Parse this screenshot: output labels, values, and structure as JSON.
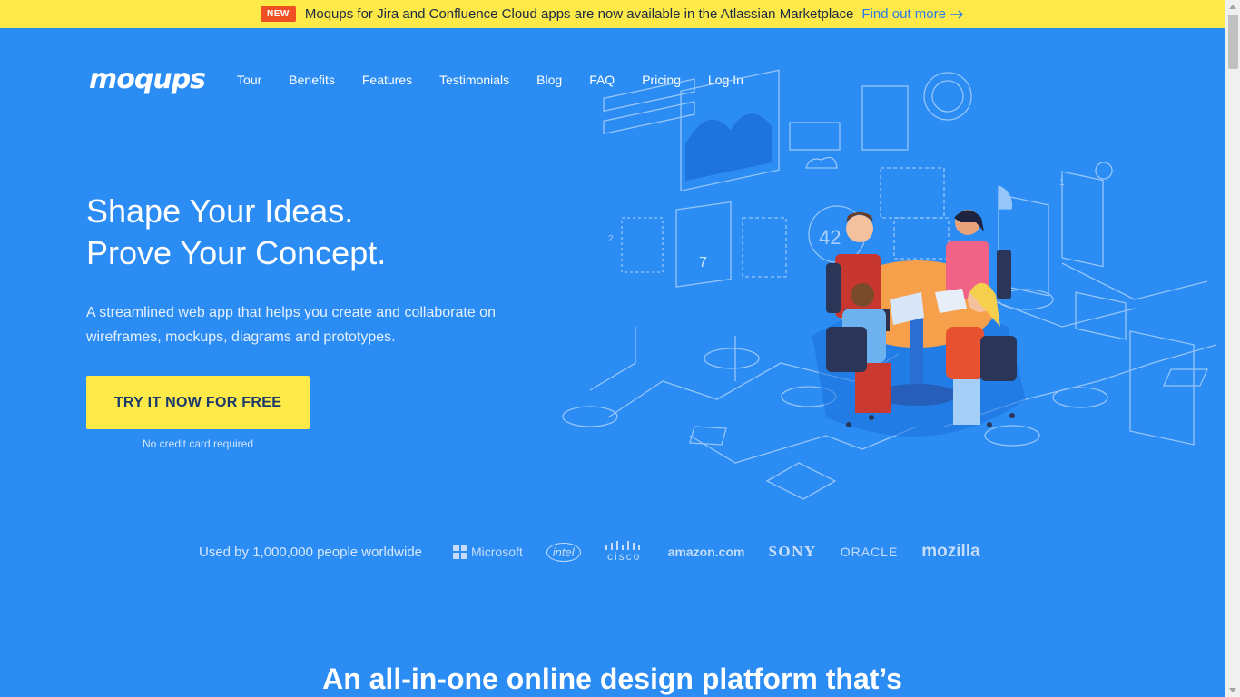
{
  "announcement": {
    "badge": "NEW",
    "text": "Moqups for Jira and Confluence Cloud apps are now available in the Atlassian Marketplace",
    "link": "Find out more"
  },
  "brand": {
    "logo": "moqups"
  },
  "nav": {
    "items": [
      "Tour",
      "Benefits",
      "Features",
      "Testimonials",
      "Blog",
      "FAQ",
      "Pricing",
      "Log In"
    ]
  },
  "hero": {
    "title_line1": "Shape Your Ideas.",
    "title_line2": "Prove Your Concept.",
    "description": "A streamlined web app that helps you create and collaborate on wireframes, mockups, diagrams and prototypes.",
    "cta": "TRY IT NOW FOR FREE",
    "cta_note": "No credit card required"
  },
  "illustration": {
    "counter_number": "42",
    "dial_number": "7",
    "step_number": "2",
    "step_number_2": "1"
  },
  "trust": {
    "label": "Used by 1,000,000 people worldwide",
    "brands": [
      "Microsoft",
      "intel",
      "cisco",
      "amazon.com",
      "SONY",
      "ORACLE",
      "mozilla"
    ]
  },
  "section": {
    "heading": "An all-in-one online design platform that’s"
  },
  "colors": {
    "background": "#2b8cf3",
    "banner": "#fde948",
    "badge": "#ef4f23",
    "link": "#2b7de9"
  }
}
